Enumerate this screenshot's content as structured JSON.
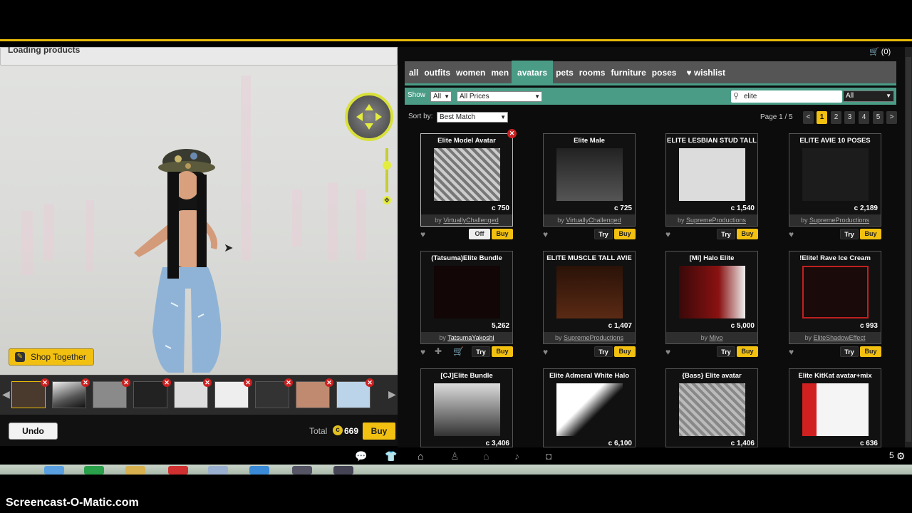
{
  "loading_text": "Loading products",
  "cart": {
    "label": "(0)"
  },
  "categories": [
    "all",
    "outfits",
    "women",
    "men",
    "avatars",
    "pets",
    "rooms",
    "furniture",
    "poses",
    "wishlist"
  ],
  "active_category": "avatars",
  "filters": {
    "show_label": "Show",
    "show_value": "All",
    "price_value": "All Prices",
    "search_value": "elite",
    "scope_value": "All"
  },
  "sort": {
    "label": "Sort by:",
    "value": "Best Match"
  },
  "pagination": {
    "label": "Page 1 / 5",
    "pages": [
      "1",
      "2",
      "3",
      "4",
      "5"
    ],
    "current": "1",
    "prev": "<",
    "next": ">"
  },
  "products": [
    {
      "title": "Elite Model Avatar",
      "price": "c 750",
      "creator": "VirtuallyChallenged",
      "actions": [
        "Off",
        "Buy"
      ]
    },
    {
      "title": "Elite Male",
      "price": "c 725",
      "creator": "VirtuallyChallenged",
      "actions": [
        "Try",
        "Buy"
      ]
    },
    {
      "title": "ELITE LESBIAN STUD TALL",
      "price": "c 1,540",
      "creator": "SupremeProductions",
      "actions": [
        "Try",
        "Buy"
      ]
    },
    {
      "title": "ELITE AVIE 10 POSES",
      "price": "c 2,189",
      "creator": "SupremeProductions",
      "actions": [
        "Try",
        "Buy"
      ]
    },
    {
      "title": "(Tatsuma)Elite Bundle",
      "price": "5,262",
      "creator": "TatsumaYakoshi",
      "actions": [
        "Try",
        "Buy"
      ]
    },
    {
      "title": "ELITE MUSCLE TALL AVIE",
      "price": "c 1,407",
      "creator": "SupremeProductions",
      "actions": [
        "Try",
        "Buy"
      ]
    },
    {
      "title": "[Mi] Halo Elite",
      "price": "c 5,000",
      "creator": "Miyo",
      "actions": [
        "Try",
        "Buy"
      ]
    },
    {
      "title": "!Elite! Rave Ice Cream",
      "price": "c 993",
      "creator": "EliteShadowEffect",
      "actions": [
        "Try",
        "Buy"
      ]
    },
    {
      "title": "[CJ]Elite Bundle",
      "price": "c 3,406",
      "creator": "",
      "actions": []
    },
    {
      "title": "Elite Admeral White Halo",
      "price": "c 6,100",
      "creator": "",
      "actions": []
    },
    {
      "title": "{Bass} Elite avatar",
      "price": "c 1,406",
      "creator": "",
      "actions": []
    },
    {
      "title": "Elite KitKat avatar+mix",
      "price": "c 636",
      "creator": "",
      "actions": []
    }
  ],
  "creator_prefix": "by",
  "shop_together": "Shop Together",
  "undo": "Undo",
  "total": {
    "label": "Total",
    "value": "669",
    "buy": "Buy"
  },
  "page_counter": "5",
  "watermark": "Screencast-O-Matic.com",
  "accent": "#4a9c86",
  "button_color": "#f2c010"
}
